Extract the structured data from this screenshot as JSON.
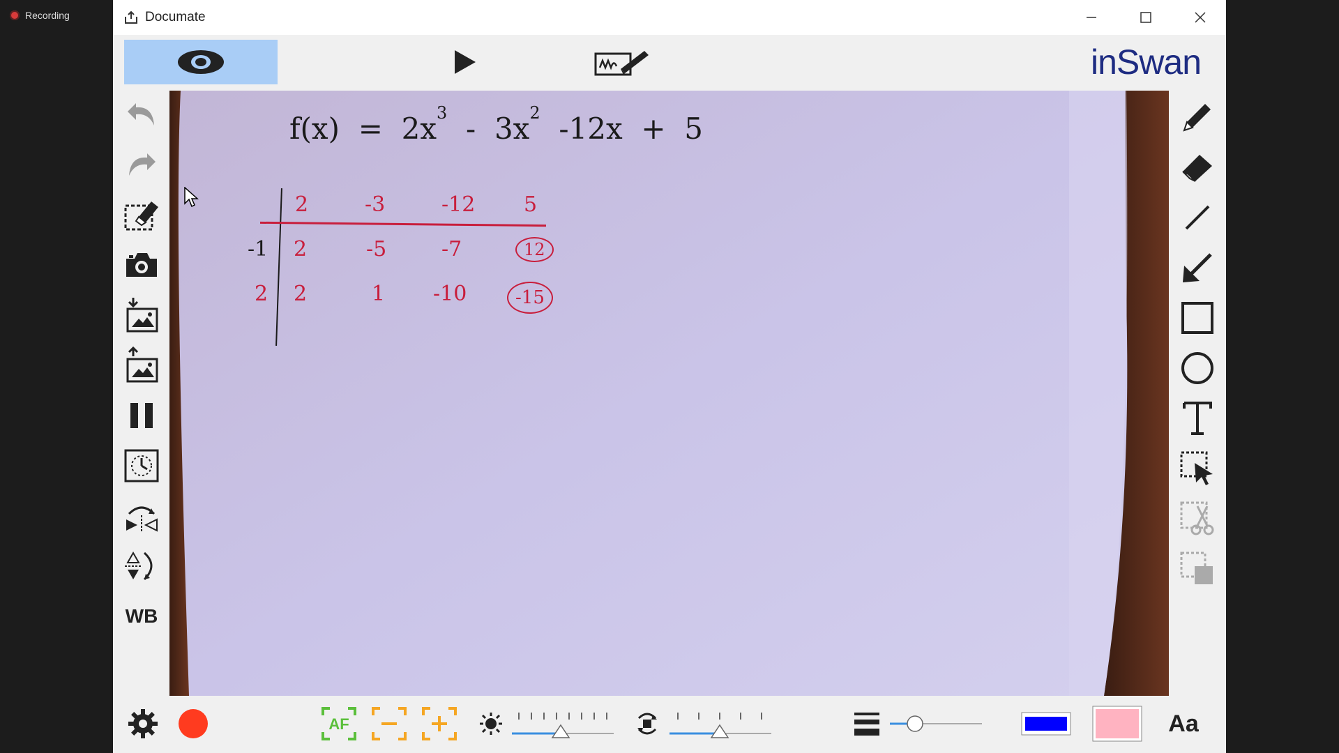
{
  "taskbar": {
    "recording_label": "Recording"
  },
  "window": {
    "title": "Documate"
  },
  "brand": {
    "part1": "in",
    "part2": "Swan"
  },
  "left_tools": {
    "whiteboard_label": "WB"
  },
  "bottom": {
    "text_style_label": "Aa",
    "pen_color": "#0000ff",
    "fill_color": "#ffb3c1"
  },
  "canvas_math": {
    "function_lhs": "f(x)",
    "function_eq": "=",
    "term1": "2x",
    "exp1": "3",
    "op1": "-",
    "term2": "3x",
    "exp2": "2",
    "term3": "-12x",
    "op3": "+",
    "term4": "5",
    "rows": [
      {
        "divisor": "",
        "cells": [
          "2",
          "-3",
          "-12",
          "5"
        ]
      },
      {
        "divisor": "-1",
        "cells": [
          "2",
          "-5",
          "-7",
          "12"
        ]
      },
      {
        "divisor": "2",
        "cells": [
          "2",
          "1",
          "-10",
          "-15"
        ]
      }
    ]
  },
  "colors": {
    "accent": "#a9cdf6",
    "brand": "#1e2c82",
    "record": "#ff3b1f",
    "af_green": "#5bbf3b",
    "zoom_orange": "#f5a623"
  }
}
